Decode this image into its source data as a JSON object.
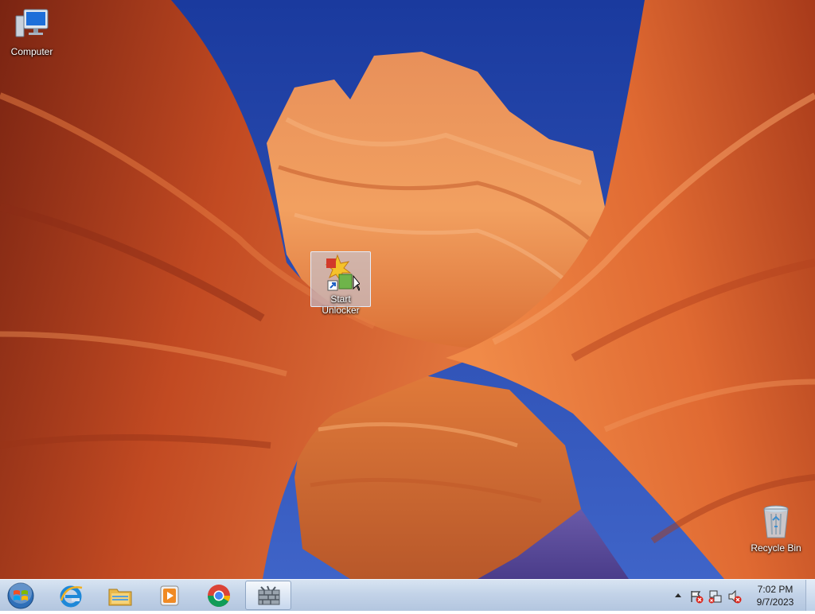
{
  "desktop": {
    "icons": [
      {
        "label": "Computer"
      },
      {
        "label": "Start Unlocker"
      },
      {
        "label": "Recycle Bin"
      }
    ]
  },
  "taskbar": {
    "start_button": "start-orb-icon",
    "pinned": [
      {
        "name": "internet-explorer-icon"
      },
      {
        "name": "file-explorer-icon"
      },
      {
        "name": "media-player-icon"
      },
      {
        "name": "chrome-icon"
      },
      {
        "name": "unlocker-app-icon",
        "active": true
      }
    ],
    "tray_icons": [
      "show-hidden-icons-icon",
      "action-center-icon",
      "network-icon",
      "volume-muted-icon"
    ],
    "clock": {
      "time": "7:02 PM",
      "date": "9/7/2023"
    }
  },
  "colors": {
    "sky": "#1f3f9c",
    "rock": "#d0562a",
    "taskbar": "#c3d3e8"
  }
}
